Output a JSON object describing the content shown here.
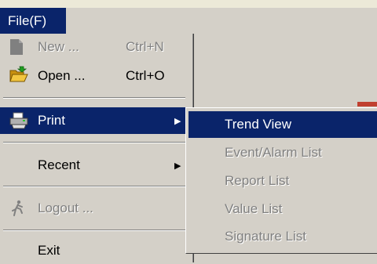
{
  "menubar": {
    "file_label": "File(F)"
  },
  "menu": {
    "new": {
      "label": "New ...",
      "shortcut": "Ctrl+N",
      "icon": "new-document-icon"
    },
    "open": {
      "label": "Open ...",
      "shortcut": "Ctrl+O",
      "icon": "open-folder-icon"
    },
    "print": {
      "label": "Print",
      "icon": "printer-icon"
    },
    "recent": {
      "label": "Recent"
    },
    "logout": {
      "label": "Logout ...",
      "icon": "running-man-icon"
    },
    "exit": {
      "label": "Exit"
    }
  },
  "submenu": {
    "items": [
      {
        "label": "Trend View"
      },
      {
        "label": "Event/Alarm List"
      },
      {
        "label": "Report List"
      },
      {
        "label": "Value List"
      },
      {
        "label": "Signature List"
      }
    ]
  },
  "colors": {
    "highlight": "#0a246a",
    "menu_bg": "#d4d0c8",
    "disabled_text": "#808080"
  }
}
